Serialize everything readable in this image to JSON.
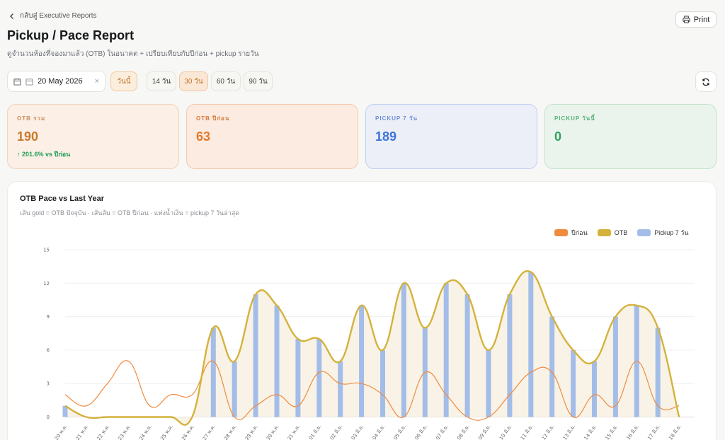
{
  "header": {
    "back_label": "กลับสู่ Executive Reports",
    "title": "Pickup / Pace Report",
    "subtitle": "ดูจำนวนห้องที่จองมาแล้ว (OTB) ในอนาคต + เปรียบเทียบกับปีก่อน + pickup รายวัน",
    "print_label": "Print"
  },
  "filters": {
    "date_value": "20 May 2026",
    "clear_symbol": "×",
    "today_label": "วันนี้",
    "ranges": [
      "14 วัน",
      "30 วัน",
      "60 วัน",
      "90 วัน"
    ],
    "active_range": "30 วัน"
  },
  "kpis": [
    {
      "label": "OTB รวม",
      "value": "190",
      "delta": "↑ 201.6% vs ปีก่อน"
    },
    {
      "label": "OTB ปีก่อน",
      "value": "63"
    },
    {
      "label": "PICKUP 7 วัน",
      "value": "189"
    },
    {
      "label": "PICKUP วันนี้",
      "value": "0"
    }
  ],
  "colors": {
    "last_year": "#f08a3e",
    "otb": "#d4b23c",
    "pickup": "#a3bde8"
  },
  "chart_card": {
    "title": "OTB Pace vs Last Year",
    "subtitle": "เส้น gold = OTB ปัจจุบัน · เส้นส้ม = OTB ปีก่อน · แท่งน้ำเงิน = pickup 7 วันล่าสุด"
  },
  "chart_data": {
    "type": "line",
    "x": [
      "20 พ.ค.",
      "21 พ.ค.",
      "22 พ.ค.",
      "23 พ.ค.",
      "24 พ.ค.",
      "25 พ.ค.",
      "26 พ.ค.",
      "27 พ.ค.",
      "28 พ.ค.",
      "29 พ.ค.",
      "30 พ.ค.",
      "31 พ.ค.",
      "01 มิ.ย.",
      "02 มิ.ย.",
      "03 มิ.ย.",
      "04 มิ.ย.",
      "05 มิ.ย.",
      "06 มิ.ย.",
      "07 มิ.ย.",
      "08 มิ.ย.",
      "09 มิ.ย.",
      "10 มิ.ย.",
      "11 มิ.ย.",
      "12 มิ.ย.",
      "13 มิ.ย.",
      "14 มิ.ย.",
      "15 มิ.ย.",
      "16 มิ.ย.",
      "17 มิ.ย.",
      "18 มิ.ย."
    ],
    "series": [
      {
        "name": "ปีก่อน",
        "type": "line",
        "values": [
          2,
          1,
          3,
          5,
          1,
          2,
          2,
          5,
          0,
          1,
          2,
          1,
          4,
          3,
          3,
          2,
          0,
          4,
          2,
          0,
          0,
          2,
          4,
          4,
          0,
          2,
          1,
          5,
          1,
          1
        ]
      },
      {
        "name": "OTB",
        "type": "area",
        "values": [
          1,
          0,
          0,
          0,
          0,
          0,
          0,
          8,
          5,
          11,
          10,
          7,
          7,
          5,
          10,
          6,
          12,
          8,
          12,
          11,
          6,
          11,
          13,
          9,
          6,
          5,
          9,
          10,
          8,
          0
        ]
      },
      {
        "name": "Pickup 7 วัน",
        "type": "bar",
        "values": [
          1,
          0,
          0,
          0,
          0,
          0,
          0,
          8,
          5,
          11,
          10,
          7,
          7,
          5,
          10,
          6,
          12,
          8,
          12,
          11,
          6,
          11,
          13,
          9,
          6,
          5,
          9,
          10,
          8,
          0
        ]
      }
    ],
    "yticks": [
      "0",
      "3",
      "6",
      "9",
      "12",
      "15"
    ],
    "ylim": [
      0,
      15
    ],
    "legend_position": "top-right",
    "grid": true
  }
}
